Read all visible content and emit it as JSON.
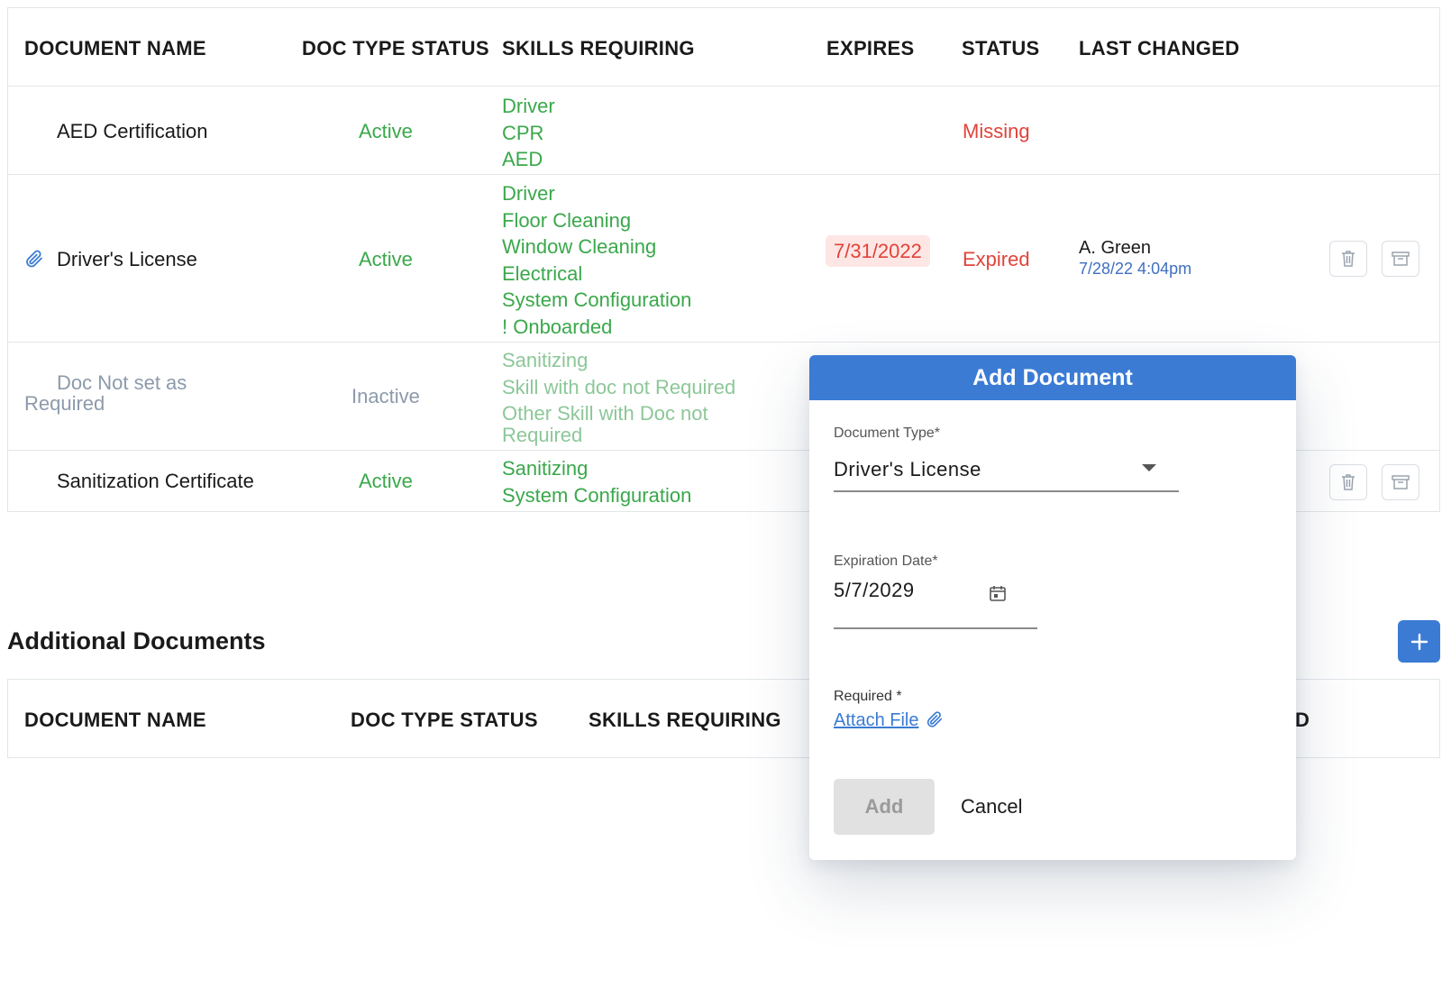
{
  "required_table": {
    "columns": [
      "DOCUMENT NAME",
      "DOC TYPE STATUS",
      "SKILLS REQUIRING",
      "EXPIRES",
      "STATUS",
      "LAST CHANGED"
    ],
    "rows": [
      {
        "name": "AED Certification",
        "doc_type_status": "Active",
        "skills": [
          "Driver",
          "CPR",
          "AED"
        ],
        "expires": "",
        "status": "Missing",
        "changed_by": "",
        "changed_at": ""
      },
      {
        "name": "Driver's License",
        "doc_type_status": "Active",
        "skills": [
          "Driver",
          "Floor Cleaning",
          "Window Cleaning",
          "Electrical",
          "System Configuration",
          "! Onboarded"
        ],
        "expires": "7/31/2022",
        "status": "Expired",
        "changed_by": "A. Green",
        "changed_at": "7/28/22 4:04pm"
      },
      {
        "name": "Doc Not set as Required",
        "name_line1": "Doc Not set as",
        "name_line2": "Required",
        "doc_type_status": "Inactive",
        "skills": [
          "Sanitizing",
          "Skill with doc not Required",
          "Other Skill with Doc not",
          "Required"
        ],
        "expires": "",
        "status": "",
        "changed_by": "",
        "changed_at": ""
      },
      {
        "name": "Sanitization Certificate",
        "doc_type_status": "Active",
        "skills": [
          "Sanitizing",
          "System Configuration"
        ],
        "expires": "",
        "status": "",
        "changed_by": "",
        "changed_at": ""
      }
    ]
  },
  "additional_documents": {
    "title": "Additional Documents",
    "columns": [
      "DOCUMENT NAME",
      "DOC TYPE STATUS",
      "SKILLS REQUIRING"
    ],
    "partial_column_text": "D"
  },
  "modal": {
    "title": "Add Document",
    "document_type_label": "Document Type*",
    "document_type_value": "Driver's License",
    "expiration_label": "Expiration Date*",
    "expiration_value": "5/7/2029",
    "required_label": "Required *",
    "attach_label": "Attach File",
    "add_label": "Add",
    "cancel_label": "Cancel"
  },
  "icons": {
    "attachment": "paperclip-icon",
    "delete": "trash-icon",
    "archive": "archive-icon",
    "calendar": "calendar-icon",
    "dropdown": "caret-down-icon",
    "add": "plus-icon"
  },
  "colors": {
    "primary": "#3b7bd4",
    "active_green": "#3aa84b",
    "error_red": "#e0433a",
    "muted": "#8c9aab"
  }
}
